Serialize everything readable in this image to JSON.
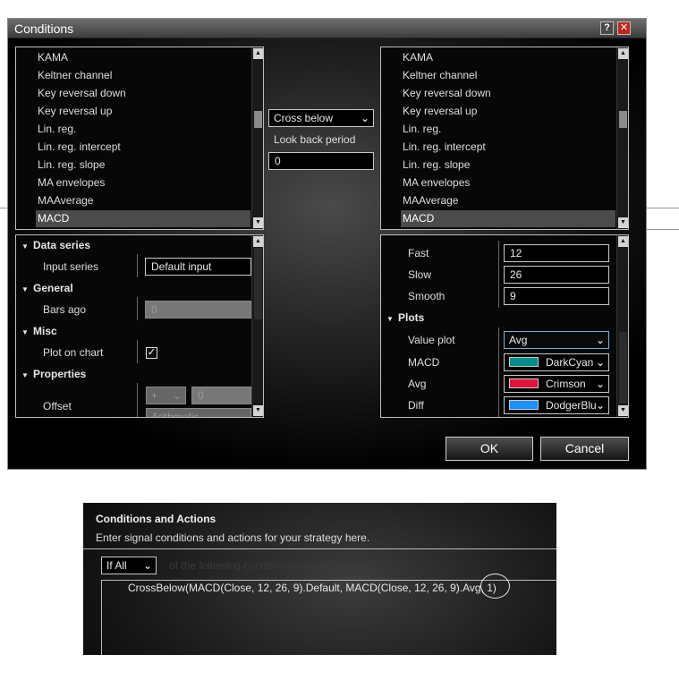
{
  "dialog": {
    "title": "Conditions",
    "help_label": "?",
    "close_label": "✕",
    "ok_label": "OK",
    "cancel_label": "Cancel"
  },
  "left_list": {
    "items": [
      "KAMA",
      "Keltner channel",
      "Key reversal down",
      "Key reversal up",
      "Lin. reg.",
      "Lin. reg. intercept",
      "Lin. reg. slope",
      "MA envelopes",
      "MAAverage",
      "MACD"
    ],
    "selected": "MACD"
  },
  "right_list": {
    "items": [
      "KAMA",
      "Keltner channel",
      "Key reversal down",
      "Key reversal up",
      "Lin. reg.",
      "Lin. reg. intercept",
      "Lin. reg. slope",
      "MA envelopes",
      "MAAverage",
      "MACD"
    ],
    "selected": "MACD"
  },
  "middle": {
    "operator": "Cross below",
    "lookback_label": "Look back period",
    "lookback_value": "0"
  },
  "left_props": {
    "data_series": "Data series",
    "input_series_label": "Input series",
    "input_series_value": "Default input",
    "general": "General",
    "bars_ago_label": "Bars ago",
    "bars_ago_value": "0",
    "misc": "Misc",
    "plot_on_chart_label": "Plot on chart",
    "plot_on_chart_check": "✓",
    "properties": "Properties",
    "offset_label": "Offset",
    "offset_sign": "+",
    "offset_value": "0",
    "offset_type": "Arithmetic"
  },
  "right_props": {
    "fast_label": "Fast",
    "fast_value": "12",
    "slow_label": "Slow",
    "slow_value": "26",
    "smooth_label": "Smooth",
    "smooth_value": "9",
    "plots": "Plots",
    "value_plot_label": "Value plot",
    "value_plot_value": "Avg",
    "macd_label": "MACD",
    "macd_color_name": "DarkCyan",
    "macd_color": "#008b8b",
    "avg_label": "Avg",
    "avg_color_name": "Crimson",
    "avg_color": "#dc143c",
    "diff_label": "Diff",
    "diff_color_name": "DodgerBlu",
    "diff_color": "#1e90ff"
  },
  "conditions_actions": {
    "title": "Conditions and Actions",
    "subtitle": "Enter signal conditions and actions for your strategy here.",
    "if_value": "If All",
    "faded_text": "of the following conditions are met",
    "expression": "CrossBelow(MACD(Close, 12, 26, 9).Default, MACD(Close, 12, 26, 9).Avg, 1)"
  }
}
